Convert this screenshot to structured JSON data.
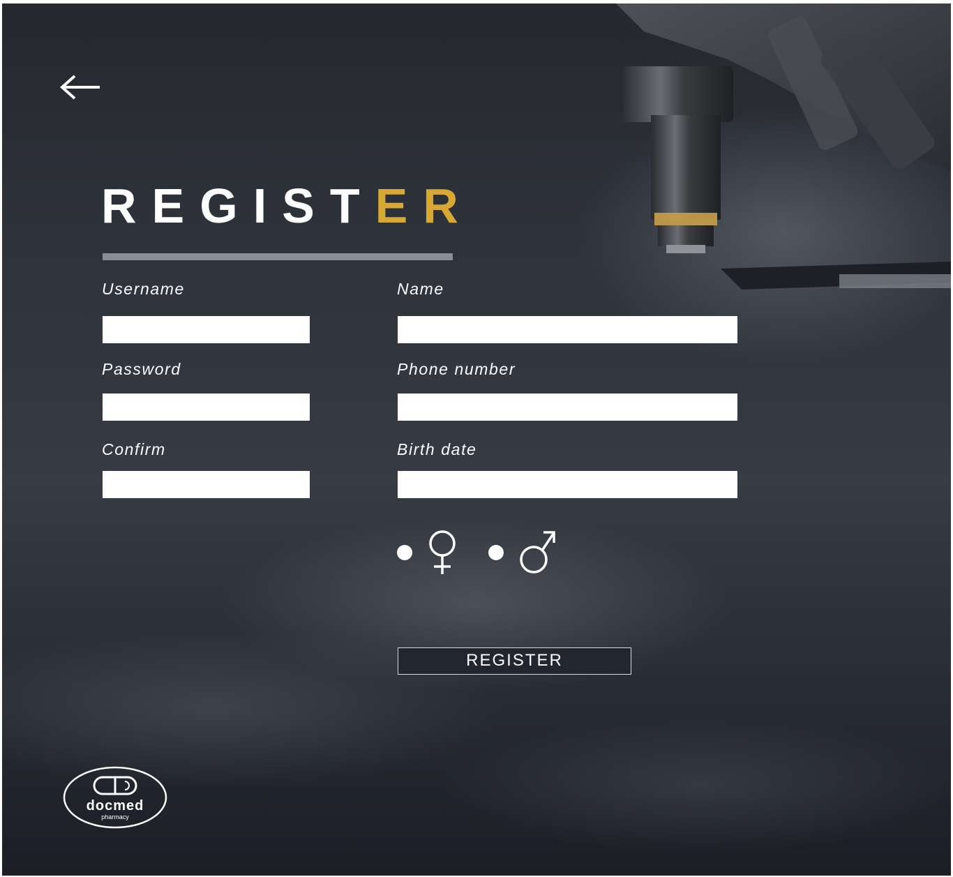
{
  "header": {
    "title_main": "REGIST",
    "title_accent": "ER"
  },
  "form": {
    "username": {
      "label": "Username",
      "value": ""
    },
    "name": {
      "label": "Name",
      "value": ""
    },
    "password": {
      "label": "Password",
      "value": ""
    },
    "phone": {
      "label": "Phone number",
      "value": ""
    },
    "confirm": {
      "label": "Confirm",
      "value": ""
    },
    "birth_date": {
      "label": "Birth date",
      "value": ""
    },
    "gender": {
      "options": [
        {
          "icon": "female-icon",
          "symbol": "♀"
        },
        {
          "icon": "male-icon",
          "symbol": "♂"
        }
      ]
    },
    "submit_label": "REGISTER"
  },
  "logo": {
    "name": "docmed",
    "subtitle": "pharmacy",
    "icon": "pill-icon"
  },
  "icons": {
    "back": "back-arrow-icon"
  },
  "colors": {
    "accent": "#d7a934",
    "text": "#ffffff",
    "underline": "#8a8d93",
    "background": "#2f333b"
  }
}
